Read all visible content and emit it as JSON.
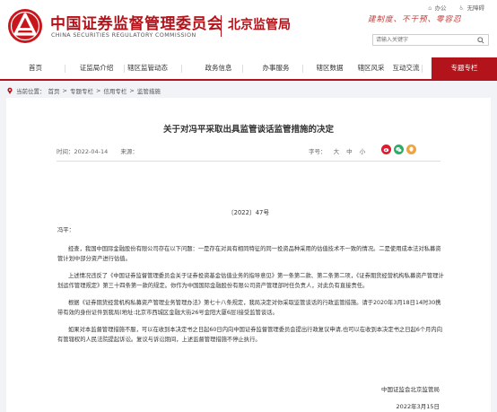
{
  "header": {
    "logo_cn": "中国证券监督管理委员会",
    "logo_en": "CHINA SECURITIES REGULATORY COMMISSION",
    "bureau": "北京监管局",
    "links": [
      "办公",
      "无障碍"
    ],
    "slogan": "建制度、不干预、零容忍",
    "search_placeholder": "请输入关键字"
  },
  "nav": {
    "items": [
      "首页",
      "证监局介绍",
      "辖区监管动态",
      "政务信息",
      "办事服务",
      "辖区数据",
      "辖区风采",
      "互动交流",
      "专题专栏"
    ],
    "active_index": 8
  },
  "breadcrumb": {
    "label": "当前位置：",
    "items": [
      "首页",
      "专题专栏",
      "信用专栏",
      "监管措施"
    ],
    "sep": ">"
  },
  "article": {
    "title": "关于对冯平采取出具监管谈话监管措施的决定",
    "time_label": "时间：2022-04-14",
    "source_label": "来源：",
    "font_label": "字号：",
    "font_sizes": [
      "大",
      "中",
      "小"
    ],
    "share_icons": [
      "weibo-icon",
      "wechat-icon",
      "qq-icon"
    ],
    "doc_number": "〔2022〕47号",
    "salutation": "冯平：",
    "paragraphs": [
      "经查，我国中国际金融股份有限公司存在以下问题：一是存在对具有相同特征的同一投资品种采用的估值技术不一致的情况。二是使用成本法对私募资管计划中部分资产进行估值。",
      "上述情况违反了《中国证券监督管理委员会关于证券投资基金估值业务的指导意见》第一条第二款、第二条第二项，《证券期货经营机构私募资产管理计划运作管理规定》第三十四条第一款的规定。你作为中国国际金融股份有限公司资产管理部时任负责人，对此负有直接责任。",
      "根据《证券期货经营机构私募资产管理业务管理办法》第七十八条规定，我局决定对你采取监管谈话的行政监管措施。请于2020年3月18日14时30携带有效的身份证件到我局(地址:北京市西城区金融大街26号金阳大厦6层)接受监管谈话。",
      "如果对本监督管理措施不服，可以在收到本决定书之日起60日内向中国证券监督管理委员会提出行政复议申请,也可以在收到本决定书之日起6个月内向有管辖权的人民法院提起诉讼。复议与诉讼期间，上述监督管理措施不停止执行。"
    ],
    "signature": "中国证监会北京监管局",
    "date": "2022年3月15日"
  },
  "colors": {
    "brand_red": "#b3141b",
    "page_bg": "#f1f3f6"
  }
}
